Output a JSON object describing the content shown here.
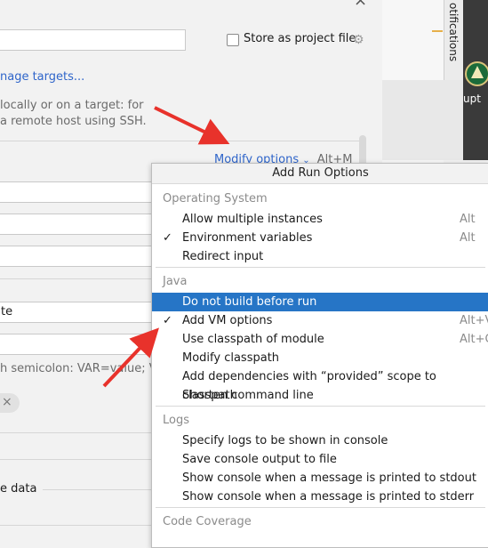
{
  "dialog": {
    "store_as_project_file_label": "Store as project file",
    "manage_targets_link": "nage targets...",
    "desc_line1": "locally or on a target: for",
    "desc_line2": "a remote host using SSH.",
    "modify_options_link": "Modify options",
    "modify_options_shortcut": "Alt+M",
    "field_value_te": "te",
    "env_hint": "h semicolon: VAR=value; VA",
    "chip_close": "×",
    "section_label_e_data": "e data"
  },
  "side": {
    "notifications_tab": "otifications",
    "partial_text": "upt"
  },
  "popup": {
    "title": "Add Run Options",
    "groups": [
      {
        "header": "Operating System",
        "items": [
          {
            "label": "Allow multiple instances",
            "shortcut": "Alt",
            "checked": false,
            "selected": false
          },
          {
            "label": "Environment variables",
            "shortcut": "Alt",
            "checked": true,
            "selected": false
          },
          {
            "label": "Redirect input",
            "shortcut": "",
            "checked": false,
            "selected": false
          }
        ]
      },
      {
        "header": "Java",
        "items": [
          {
            "label": "Do not build before run",
            "shortcut": "",
            "checked": false,
            "selected": true
          },
          {
            "label": "Add VM options",
            "shortcut": "Alt+V",
            "checked": true,
            "selected": false
          },
          {
            "label": "Use classpath of module",
            "shortcut": "Alt+C",
            "checked": false,
            "selected": false
          },
          {
            "label": "Modify classpath",
            "shortcut": "",
            "checked": false,
            "selected": false
          },
          {
            "label": "Add dependencies with “provided” scope to classpath",
            "shortcut": "",
            "checked": false,
            "selected": false
          },
          {
            "label": "Shorten command line",
            "shortcut": "",
            "checked": false,
            "selected": false
          }
        ]
      },
      {
        "header": "Logs",
        "items": [
          {
            "label": "Specify logs to be shown in console",
            "shortcut": "",
            "checked": false,
            "selected": false
          },
          {
            "label": "Save console output to file",
            "shortcut": "",
            "checked": false,
            "selected": false
          },
          {
            "label": "Show console when a message is printed to stdout",
            "shortcut": "",
            "checked": false,
            "selected": false
          },
          {
            "label": "Show console when a message is printed to stderr",
            "shortcut": "",
            "checked": false,
            "selected": false
          }
        ]
      },
      {
        "header": "Code Coverage",
        "items": []
      }
    ],
    "check_glyph": "✓",
    "selection_color": "#2675c6"
  },
  "annotations": {
    "arrow_color": "#e8322b"
  }
}
